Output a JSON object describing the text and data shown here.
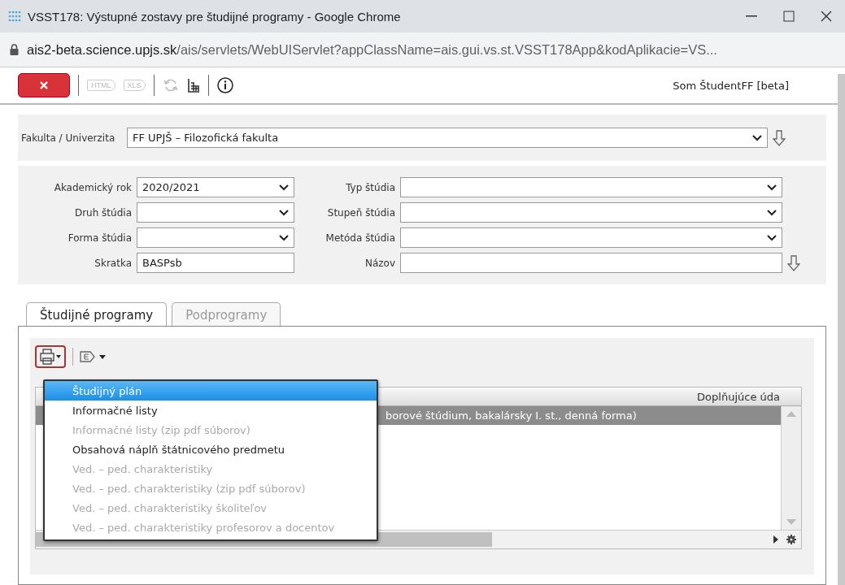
{
  "window": {
    "title": "VSST178: Výstupné zostavy pre študijné programy - Google Chrome"
  },
  "address": {
    "host": "ais2-beta.science.upjs.sk",
    "path": "/ais/servlets/WebUIServlet?appClassName=ais.gui.vs.st.VSST178App&kodAplikacie=VS..."
  },
  "toolbar": {
    "buttons": [
      {
        "label": "HTML",
        "disabled": true
      },
      {
        "label": "XLS",
        "disabled": true
      }
    ],
    "user": "Som ŠtudentFF [beta]"
  },
  "faculty": {
    "label": "Fakulta / Univerzita",
    "value": "FF UPJŠ – Filozofická fakulta"
  },
  "filters": [
    {
      "label": "Akademický rok",
      "value": "2020/2021",
      "kind": "select"
    },
    {
      "label": "Typ štúdia",
      "kind": "select"
    },
    {
      "label": "Druh štúdia",
      "kind": "select"
    },
    {
      "label": "Stupeň štúdia",
      "kind": "select"
    },
    {
      "label": "Forma štúdia",
      "kind": "select"
    },
    {
      "label": "Metóda štúdia",
      "kind": "select"
    },
    {
      "label": "Skratka",
      "value": "BASPsb",
      "kind": "text"
    },
    {
      "label": "Názov",
      "kind": "text"
    }
  ],
  "tabs": [
    {
      "label": "Študijné programy",
      "selected": true
    },
    {
      "label": "Podprogramy",
      "selected": false
    }
  ],
  "table": {
    "columns": [
      "Doplňujúce úda"
    ],
    "rows": [
      {
        "text": "borové štúdium, bakalársky I. st., denná forma)",
        "selected": true
      }
    ]
  },
  "print_menu": {
    "items": [
      {
        "label": "Študijný plán",
        "selected": true,
        "disabled": false
      },
      {
        "label": "Informačné listy",
        "selected": false,
        "disabled": false
      },
      {
        "label": "Informačné listy (zip pdf súborov)",
        "selected": false,
        "disabled": true
      },
      {
        "label": "Obsahová náplň štátnicového predmetu",
        "selected": false,
        "disabled": false
      },
      {
        "label": "Ved. – ped. charakteristiky",
        "selected": false,
        "disabled": true
      },
      {
        "label": "Ved. – ped. charakteristiky (zip pdf súborov)",
        "selected": false,
        "disabled": true
      },
      {
        "label": "Ved. – ped. charakteristiky školiteľov",
        "selected": false,
        "disabled": true
      },
      {
        "label": "Ved. – ped. charakteristiky profesorov a docentov",
        "selected": false,
        "disabled": true
      }
    ]
  }
}
